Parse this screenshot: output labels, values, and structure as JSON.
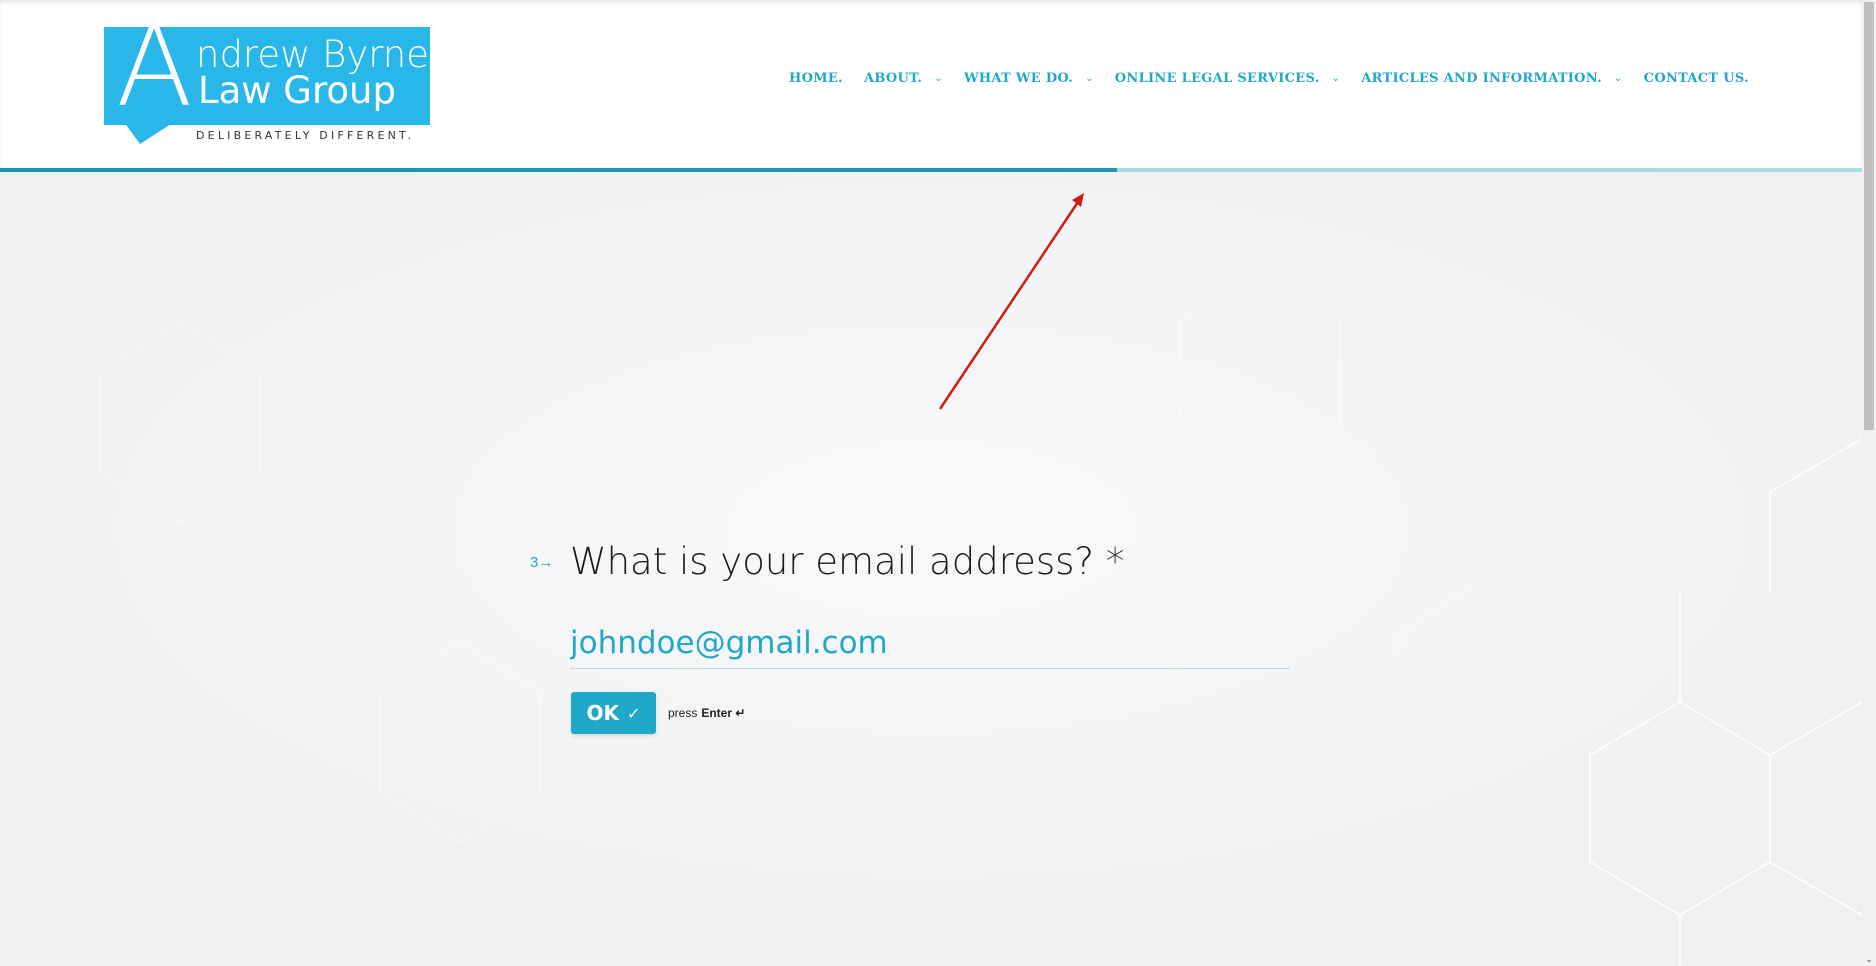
{
  "logo": {
    "initial": "A",
    "line1": "ndrew Byrnes",
    "line2": "Law Group",
    "tagline": "DELIBERATELY DIFFERENT.",
    "color": "#29b6e8"
  },
  "nav": {
    "items": [
      {
        "label": "HOME.",
        "has_dropdown": false
      },
      {
        "label": "ABOUT.",
        "has_dropdown": true
      },
      {
        "label": "WHAT WE DO.",
        "has_dropdown": true
      },
      {
        "label": "ONLINE LEGAL SERVICES.",
        "has_dropdown": true
      },
      {
        "label": "ARTICLES AND INFORMATION.",
        "has_dropdown": true
      },
      {
        "label": "CONTACT US.",
        "has_dropdown": false
      }
    ],
    "color": "#1fa8c9"
  },
  "progress": {
    "fraction": 0.6,
    "fill_color": "#1a96b5",
    "track_color": "#a8dcdf"
  },
  "form": {
    "question_number": "3",
    "question": "What is your email address? *",
    "answer_value": "johndoe@gmail.com",
    "ok_label": "OK",
    "press_label": "press",
    "enter_label": "Enter ↵"
  },
  "annotation": {
    "type": "red-arrow",
    "color": "#d11a1a"
  },
  "icons": {
    "check": "check-icon",
    "arrow": "right-arrow-icon",
    "chevron": "chevron-down-icon"
  }
}
